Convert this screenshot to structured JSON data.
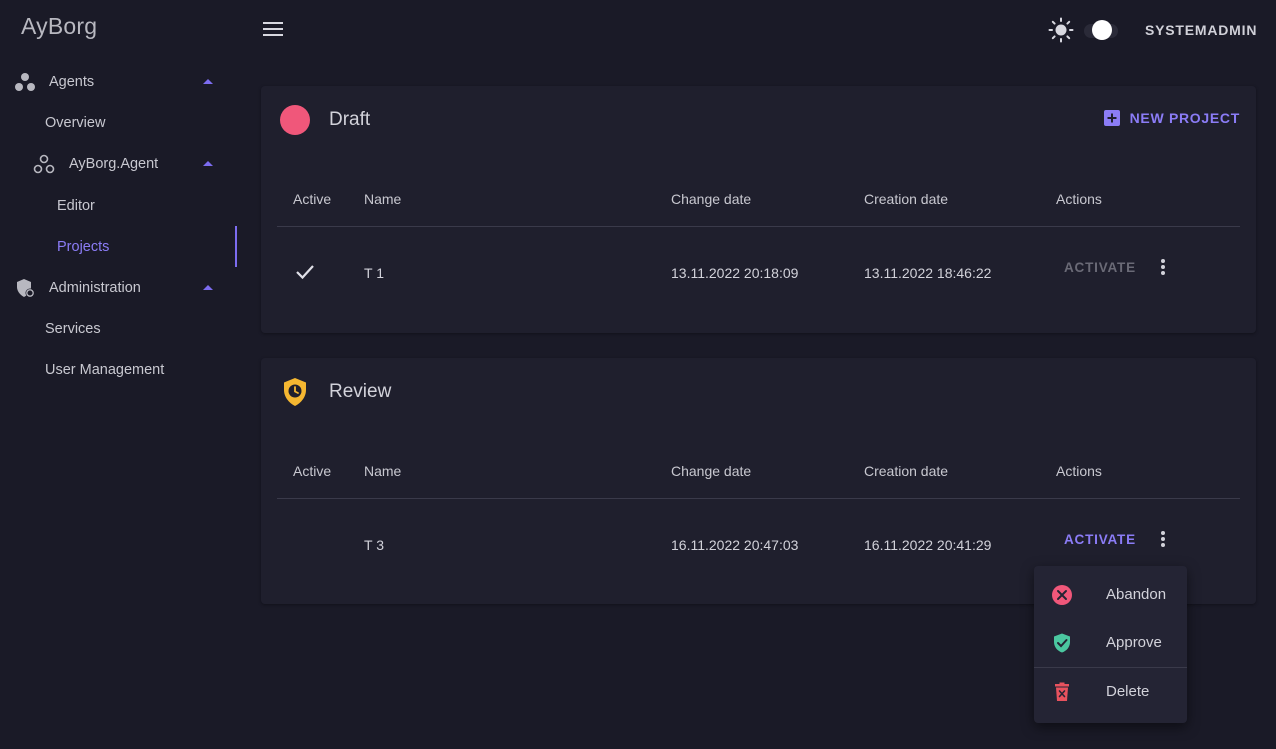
{
  "app": {
    "brand": "AyBorg"
  },
  "header": {
    "user_label": "SYSTEMADMIN",
    "icons": {
      "menu": "menu-icon",
      "theme": "sun-icon"
    }
  },
  "sidebar": {
    "agents": "Agents",
    "overview": "Overview",
    "agent_name": "AyBorg.Agent",
    "editor": "Editor",
    "projects": "Projects",
    "administration": "Administration",
    "services": "Services",
    "user_management": "User Management"
  },
  "table_headers": {
    "active": "Active",
    "name": "Name",
    "change_date": "Change date",
    "creation_date": "Creation date",
    "actions": "Actions"
  },
  "draft": {
    "title": "Draft",
    "new_project_label": "NEW PROJECT",
    "rows": [
      {
        "active": true,
        "name": "T 1",
        "change_date": "13.11.2022 20:18:09",
        "creation_date": "13.11.2022 18:46:22",
        "action": "ACTIVATE"
      }
    ]
  },
  "review": {
    "title": "Review",
    "rows": [
      {
        "active": false,
        "name": "T 3",
        "change_date": "16.11.2022 20:47:03",
        "creation_date": "16.11.2022 20:41:29",
        "action": "ACTIVATE"
      }
    ]
  },
  "context_menu": {
    "abandon": "Abandon",
    "approve": "Approve",
    "delete": "Delete"
  },
  "colors": {
    "accent": "#8b7cf6",
    "draft": "#f0577a",
    "review": "#f5b731",
    "approve": "#4bc7a0",
    "delete": "#e8525e",
    "background": "#1a1a27",
    "card": "#1f1f2d"
  }
}
